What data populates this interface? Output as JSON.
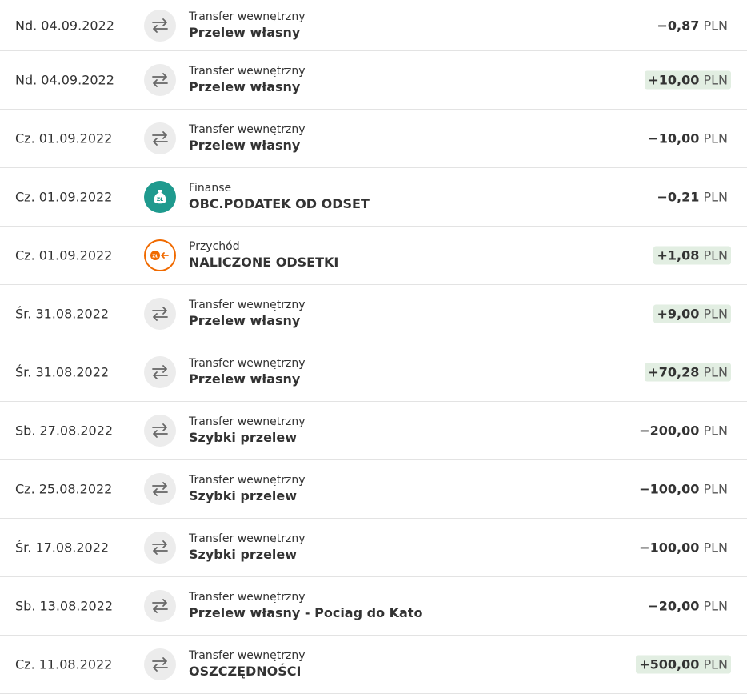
{
  "colors": {
    "positive_bg": "#e2eee2",
    "finance_icon": "#1f9a8e",
    "income_icon": "#f06a00",
    "transfer_icon_bg": "#ececec"
  },
  "transactions": [
    {
      "date": "Nd. 04.09.2022",
      "icon": "transfer-arrows-icon",
      "category": "Transfer wewnętrzny",
      "title": "Przelew własny",
      "amount": "−0,87",
      "currency": "PLN",
      "positive": false
    },
    {
      "date": "Nd. 04.09.2022",
      "icon": "transfer-arrows-icon",
      "category": "Transfer wewnętrzny",
      "title": "Przelew własny",
      "amount": "+10,00",
      "currency": "PLN",
      "positive": true
    },
    {
      "date": "Cz. 01.09.2022",
      "icon": "transfer-arrows-icon",
      "category": "Transfer wewnętrzny",
      "title": "Przelew własny",
      "amount": "−10,00",
      "currency": "PLN",
      "positive": false
    },
    {
      "date": "Cz. 01.09.2022",
      "icon": "money-bag-icon",
      "category": "Finanse",
      "title": "OBC.PODATEK OD ODSET",
      "amount": "−0,21",
      "currency": "PLN",
      "positive": false
    },
    {
      "date": "Cz. 01.09.2022",
      "icon": "coin-incoming-icon",
      "category": "Przychód",
      "title": "NALICZONE ODSETKI",
      "amount": "+1,08",
      "currency": "PLN",
      "positive": true
    },
    {
      "date": "Śr. 31.08.2022",
      "icon": "transfer-arrows-icon",
      "category": "Transfer wewnętrzny",
      "title": "Przelew własny",
      "amount": "+9,00",
      "currency": "PLN",
      "positive": true
    },
    {
      "date": "Śr. 31.08.2022",
      "icon": "transfer-arrows-icon",
      "category": "Transfer wewnętrzny",
      "title": "Przelew własny",
      "amount": "+70,28",
      "currency": "PLN",
      "positive": true
    },
    {
      "date": "Sb. 27.08.2022",
      "icon": "transfer-arrows-icon",
      "category": "Transfer wewnętrzny",
      "title": "Szybki przelew",
      "amount": "−200,00",
      "currency": "PLN",
      "positive": false
    },
    {
      "date": "Cz. 25.08.2022",
      "icon": "transfer-arrows-icon",
      "category": "Transfer wewnętrzny",
      "title": "Szybki przelew",
      "amount": "−100,00",
      "currency": "PLN",
      "positive": false
    },
    {
      "date": "Śr. 17.08.2022",
      "icon": "transfer-arrows-icon",
      "category": "Transfer wewnętrzny",
      "title": "Szybki przelew",
      "amount": "−100,00",
      "currency": "PLN",
      "positive": false
    },
    {
      "date": "Sb. 13.08.2022",
      "icon": "transfer-arrows-icon",
      "category": "Transfer wewnętrzny",
      "title": "Przelew własny - Pociag do Kato",
      "amount": "−20,00",
      "currency": "PLN",
      "positive": false
    },
    {
      "date": "Cz. 11.08.2022",
      "icon": "transfer-arrows-icon",
      "category": "Transfer wewnętrzny",
      "title": "OSZCZĘDNOŚCI",
      "amount": "+500,00",
      "currency": "PLN",
      "positive": true
    }
  ]
}
